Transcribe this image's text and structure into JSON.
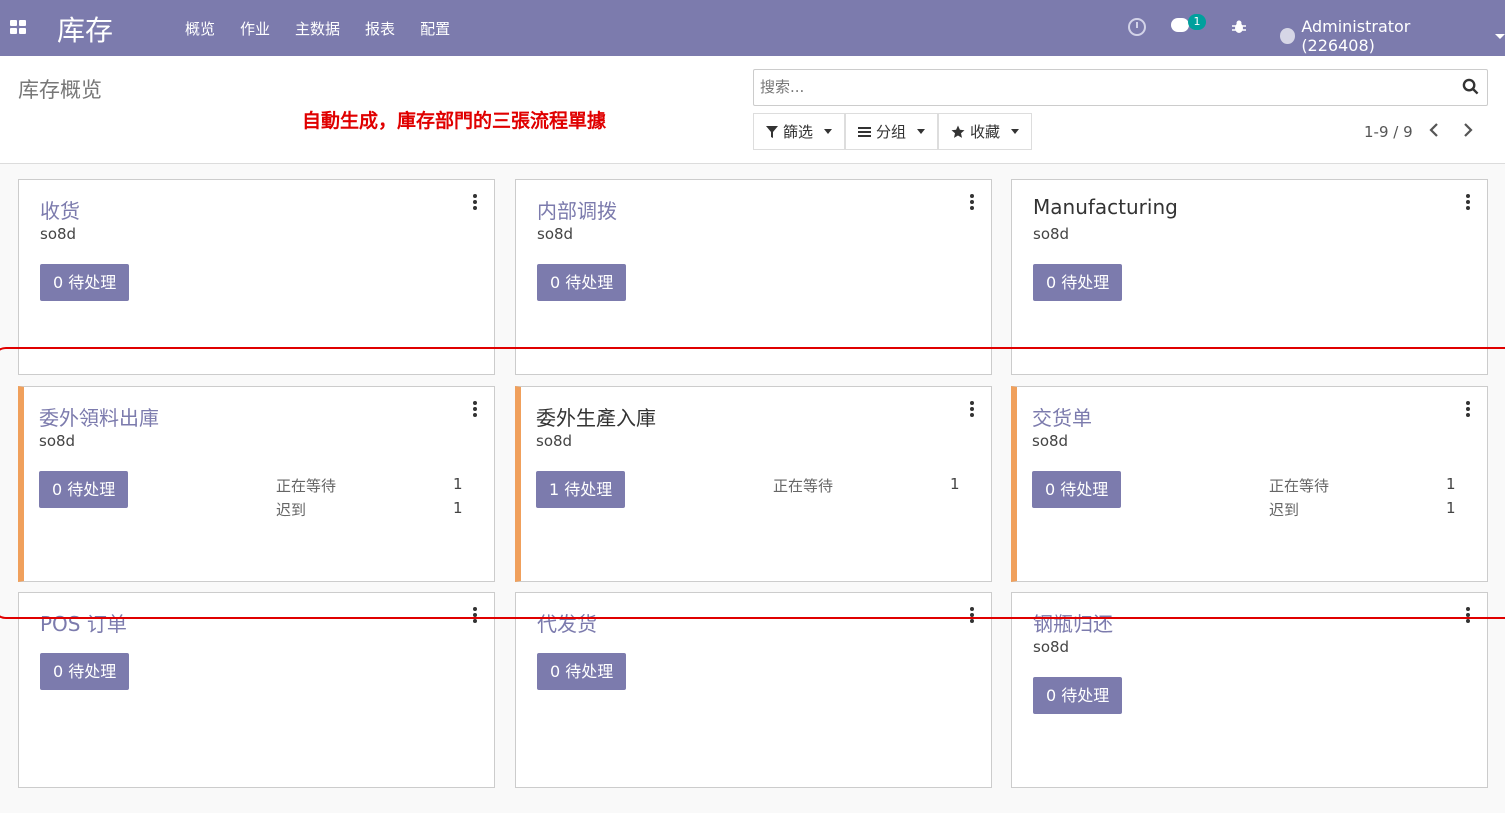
{
  "navbar": {
    "brand": "库存",
    "menu": [
      "概览",
      "作业",
      "主数据",
      "报表",
      "配置"
    ],
    "chat_count": "1",
    "user": "Administrator (226408)"
  },
  "control": {
    "title": "库存概览",
    "annotation": "自動生成，庫存部門的三張流程單據",
    "search_placeholder": "搜索...",
    "filters": [
      "篩选",
      "分组",
      "收藏"
    ],
    "pager": "1-9 / 9"
  },
  "cards": [
    {
      "title": "收货",
      "sub": "so8d",
      "button": "0 待处理"
    },
    {
      "title": "内部调拨",
      "sub": "so8d",
      "button": "0 待处理"
    },
    {
      "title": "Manufacturing",
      "sub": "so8d",
      "button": "0 待处理"
    },
    {
      "title": "委外領料出庫",
      "sub": "so8d",
      "button": "0 待处理",
      "stats": [
        {
          "label": "正在等待",
          "value": "1"
        },
        {
          "label": "迟到",
          "value": "1"
        }
      ]
    },
    {
      "title": "委外生產入庫",
      "sub": "so8d",
      "button": "1 待处理",
      "stats": [
        {
          "label": "正在等待",
          "value": "1"
        }
      ]
    },
    {
      "title": "交货单",
      "sub": "so8d",
      "button": "0 待处理",
      "stats": [
        {
          "label": "正在等待",
          "value": "1"
        },
        {
          "label": "迟到",
          "value": "1"
        }
      ]
    },
    {
      "title": "POS 订单",
      "button": "0 待处理"
    },
    {
      "title": "代发货",
      "button": "0 待处理"
    },
    {
      "title": "钢瓶归还",
      "sub": "so8d",
      "button": "0 待处理"
    }
  ],
  "colors": {
    "navbar": "#7c7bad",
    "button": "#7c7bad",
    "accent": "#f0a05c",
    "annotation": "#e00000"
  }
}
